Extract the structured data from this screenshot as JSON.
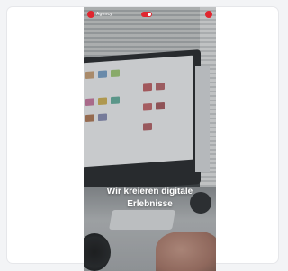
{
  "header": {
    "logo_text": "Agency",
    "logo_icon": "brand-dot-icon",
    "toggle_icon": "toggle-icon",
    "menu_icon": "menu-dot-icon"
  },
  "hero": {
    "headline_line1": "Wir kreieren digitale",
    "headline_line2": "Erlebnisse"
  },
  "colors": {
    "accent": "#e0262f",
    "text_on_image": "#ffffff",
    "page_bg": "#f3f4f6",
    "card_bg": "#ffffff"
  }
}
